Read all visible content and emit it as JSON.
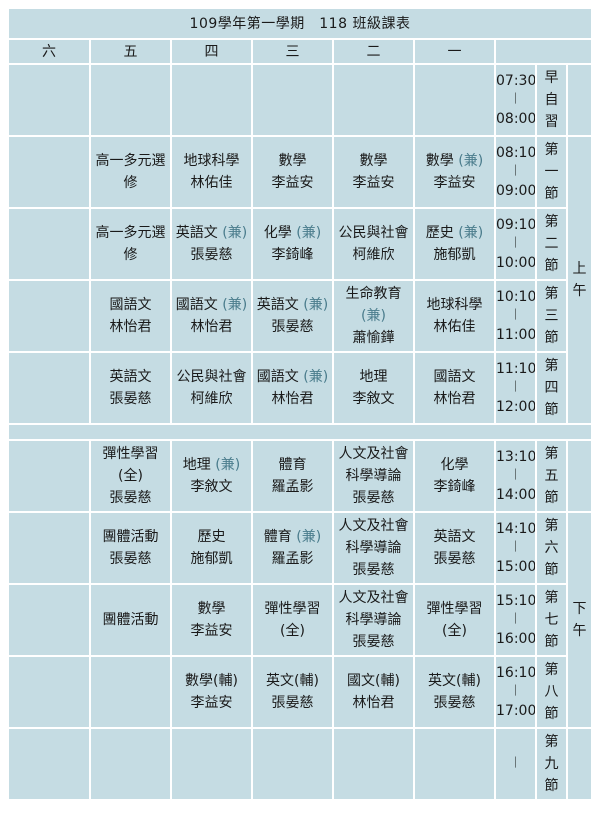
{
  "title": "109學年第一學期　118 班級課表",
  "days": [
    "六",
    "五",
    "四",
    "三",
    "二",
    "一"
  ],
  "sections": {
    "morning": "上午",
    "afternoon": "下午"
  },
  "jian": "(兼)",
  "periods": [
    {
      "start": "07:30",
      "end": "08:00",
      "label": "早自習"
    },
    {
      "start": "08:10",
      "end": "09:00",
      "label": "第一節"
    },
    {
      "start": "09:10",
      "end": "10:00",
      "label": "第二節"
    },
    {
      "start": "10:10",
      "end": "11:00",
      "label": "第三節"
    },
    {
      "start": "11:10",
      "end": "12:00",
      "label": "第四節"
    },
    {
      "start": "13:10",
      "end": "14:00",
      "label": "第五節"
    },
    {
      "start": "14:10",
      "end": "15:00",
      "label": "第六節"
    },
    {
      "start": "15:10",
      "end": "16:00",
      "label": "第七節"
    },
    {
      "start": "16:10",
      "end": "17:00",
      "label": "第八節"
    },
    {
      "start": "",
      "end": "",
      "label": "第九節"
    }
  ],
  "cells": {
    "p1": {
      "fri": {
        "subject": [
          "高一多元選",
          "修"
        ],
        "teacher": ""
      },
      "thu": {
        "subject": [
          "地球科學"
        ],
        "teacher": "林佑佳"
      },
      "wed": {
        "subject": [
          "數學"
        ],
        "teacher": "李益安"
      },
      "tue": {
        "subject": [
          "數學"
        ],
        "teacher": "李益安"
      },
      "mon": {
        "subject": [
          "數學"
        ],
        "teacher": "李益安"
      }
    },
    "p2": {
      "fri": {
        "subject": [
          "高一多元選",
          "修"
        ],
        "teacher": ""
      },
      "thu": {
        "subject": [
          "英語文"
        ],
        "teacher": "張晏慈"
      },
      "wed": {
        "subject": [
          "化學"
        ],
        "teacher": "李錡峰"
      },
      "tue": {
        "subject": [
          "公民與社會"
        ],
        "teacher": "柯維欣"
      },
      "mon": {
        "subject": [
          "歷史"
        ],
        "teacher": "施郁凱"
      }
    },
    "p3": {
      "fri": {
        "subject": [
          "國語文"
        ],
        "teacher": "林怡君"
      },
      "thu": {
        "subject": [
          "國語文"
        ],
        "teacher": "林怡君"
      },
      "wed": {
        "subject": [
          "英語文"
        ],
        "teacher": "張晏慈"
      },
      "tue": {
        "subject": [
          "生命教育"
        ],
        "teacher": "蕭愉鏵"
      },
      "mon": {
        "subject": [
          "地球科學"
        ],
        "teacher": "林佑佳"
      }
    },
    "p4": {
      "fri": {
        "subject": [
          "英語文"
        ],
        "teacher": "張晏慈"
      },
      "thu": {
        "subject": [
          "公民與社會"
        ],
        "teacher": "柯維欣"
      },
      "wed": {
        "subject": [
          "國語文"
        ],
        "teacher": "林怡君"
      },
      "tue": {
        "subject": [
          "地理"
        ],
        "teacher": "李敘文"
      },
      "mon": {
        "subject": [
          "國語文"
        ],
        "teacher": "林怡君"
      }
    },
    "p5": {
      "fri": {
        "subject": [
          "彈性學習",
          "(全)"
        ],
        "teacher": "張晏慈"
      },
      "thu": {
        "subject": [
          "地理"
        ],
        "teacher": "李敘文"
      },
      "wed": {
        "subject": [
          "體育"
        ],
        "teacher": "羅孟影"
      },
      "tue": {
        "subject": [
          "人文及社會",
          "科學導論"
        ],
        "teacher": "張晏慈"
      },
      "mon": {
        "subject": [
          "化學"
        ],
        "teacher": "李錡峰"
      }
    },
    "p6": {
      "fri": {
        "subject": [
          "團體活動"
        ],
        "teacher": "張晏慈"
      },
      "thu": {
        "subject": [
          "歷史"
        ],
        "teacher": "施郁凱"
      },
      "wed": {
        "subject": [
          "體育"
        ],
        "teacher": "羅孟影"
      },
      "tue": {
        "subject": [
          "人文及社會",
          "科學導論"
        ],
        "teacher": "張晏慈"
      },
      "mon": {
        "subject": [
          "英語文"
        ],
        "teacher": "張晏慈"
      }
    },
    "p7": {
      "fri": {
        "subject": [
          "團體活動"
        ],
        "teacher": ""
      },
      "thu": {
        "subject": [
          "數學"
        ],
        "teacher": "李益安"
      },
      "wed": {
        "subject": [
          "彈性學習",
          "(全)"
        ],
        "teacher": ""
      },
      "tue": {
        "subject": [
          "人文及社會",
          "科學導論"
        ],
        "teacher": "張晏慈"
      },
      "mon": {
        "subject": [
          "彈性學習",
          "(全)"
        ],
        "teacher": ""
      }
    },
    "p8": {
      "thu": {
        "subject": [
          "數學(輔)"
        ],
        "teacher": "李益安"
      },
      "wed": {
        "subject": [
          "英文(輔)"
        ],
        "teacher": "張晏慈"
      },
      "tue": {
        "subject": [
          "國文(輔)"
        ],
        "teacher": "林怡君"
      },
      "mon": {
        "subject": [
          "英文(輔)"
        ],
        "teacher": "張晏慈"
      }
    }
  },
  "tilde": "︱"
}
